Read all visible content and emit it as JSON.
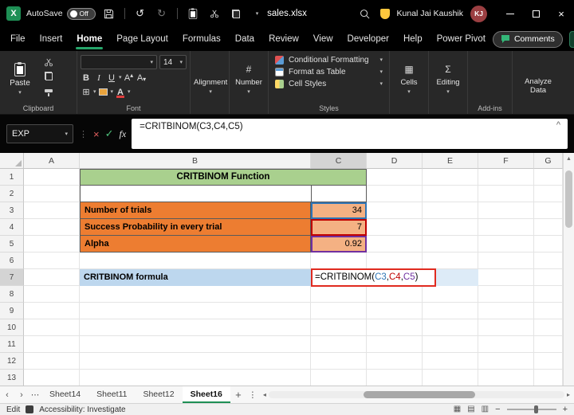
{
  "titlebar": {
    "autosave_label": "AutoSave",
    "autosave_state": "Off",
    "filename": "sales.xlsx",
    "user_name": "Kunal Jai Kaushik",
    "user_initials": "KJ"
  },
  "menubar": {
    "tabs": [
      "File",
      "Insert",
      "Home",
      "Page Layout",
      "Formulas",
      "Data",
      "Review",
      "View",
      "Developer",
      "Help",
      "Power Pivot"
    ],
    "active_tab": "Home",
    "comments_label": "Comments"
  },
  "ribbon": {
    "paste_label": "Paste",
    "clipboard_label": "Clipboard",
    "font_label": "Font",
    "font_size": "14",
    "bold": "B",
    "italic": "I",
    "underline": "U",
    "alignment_label": "Alignment",
    "number_label": "Number",
    "conditional_formatting_label": "Conditional Formatting",
    "format_as_table_label": "Format as Table",
    "cell_styles_label": "Cell Styles",
    "styles_label": "Styles",
    "cells_label": "Cells",
    "editing_label": "Editing",
    "addins_label": "Add-ins",
    "analyze_data_label": "Analyze Data"
  },
  "formula_bar": {
    "name_box": "EXP",
    "fx_label": "fx",
    "formula": "=CRITBINOM(C3,C4,C5)"
  },
  "grid": {
    "columns": [
      "A",
      "B",
      "C",
      "D",
      "E",
      "F",
      "G"
    ],
    "rows": [
      "1",
      "2",
      "3",
      "4",
      "5",
      "6",
      "7",
      "8",
      "9",
      "10",
      "11",
      "12",
      "13"
    ],
    "title": "CRITBINOM Function",
    "items": [
      {
        "label": "Number of trials",
        "value": "34",
        "border_color": "#2E75B6"
      },
      {
        "label": "Success Probability in every trial",
        "value": "7",
        "border_color": "#C00000"
      },
      {
        "label": "Alpha",
        "value": "0.92",
        "border_color": "#7030A0"
      }
    ],
    "formula_label": "CRITBINOM formula",
    "formula_parts": [
      {
        "text": "=CRITBINOM(",
        "color": "#000000"
      },
      {
        "text": "C3",
        "color": "#2E75B6"
      },
      {
        "text": ",",
        "color": "#000000"
      },
      {
        "text": "C4",
        "color": "#C00000"
      },
      {
        "text": ",",
        "color": "#000000"
      },
      {
        "text": "C5",
        "color": "#7030A0"
      },
      {
        "text": ")",
        "color": "#000000"
      }
    ],
    "edit_box_border": "#E02B20"
  },
  "sheet_tabs": {
    "tabs": [
      "Sheet14",
      "Sheet11",
      "Sheet12",
      "Sheet16"
    ],
    "active": "Sheet16"
  },
  "status_bar": {
    "mode": "Edit",
    "accessibility": "Accessibility: Investigate"
  },
  "colors": {
    "accent_green": "#21A366",
    "title_cell_green": "#A9D08E",
    "label_orange": "#ED7D31",
    "value_orange": "#F4B183",
    "formula_row_blue": "#BDD7EE",
    "formula_ext_blue": "#DDEBF7"
  }
}
